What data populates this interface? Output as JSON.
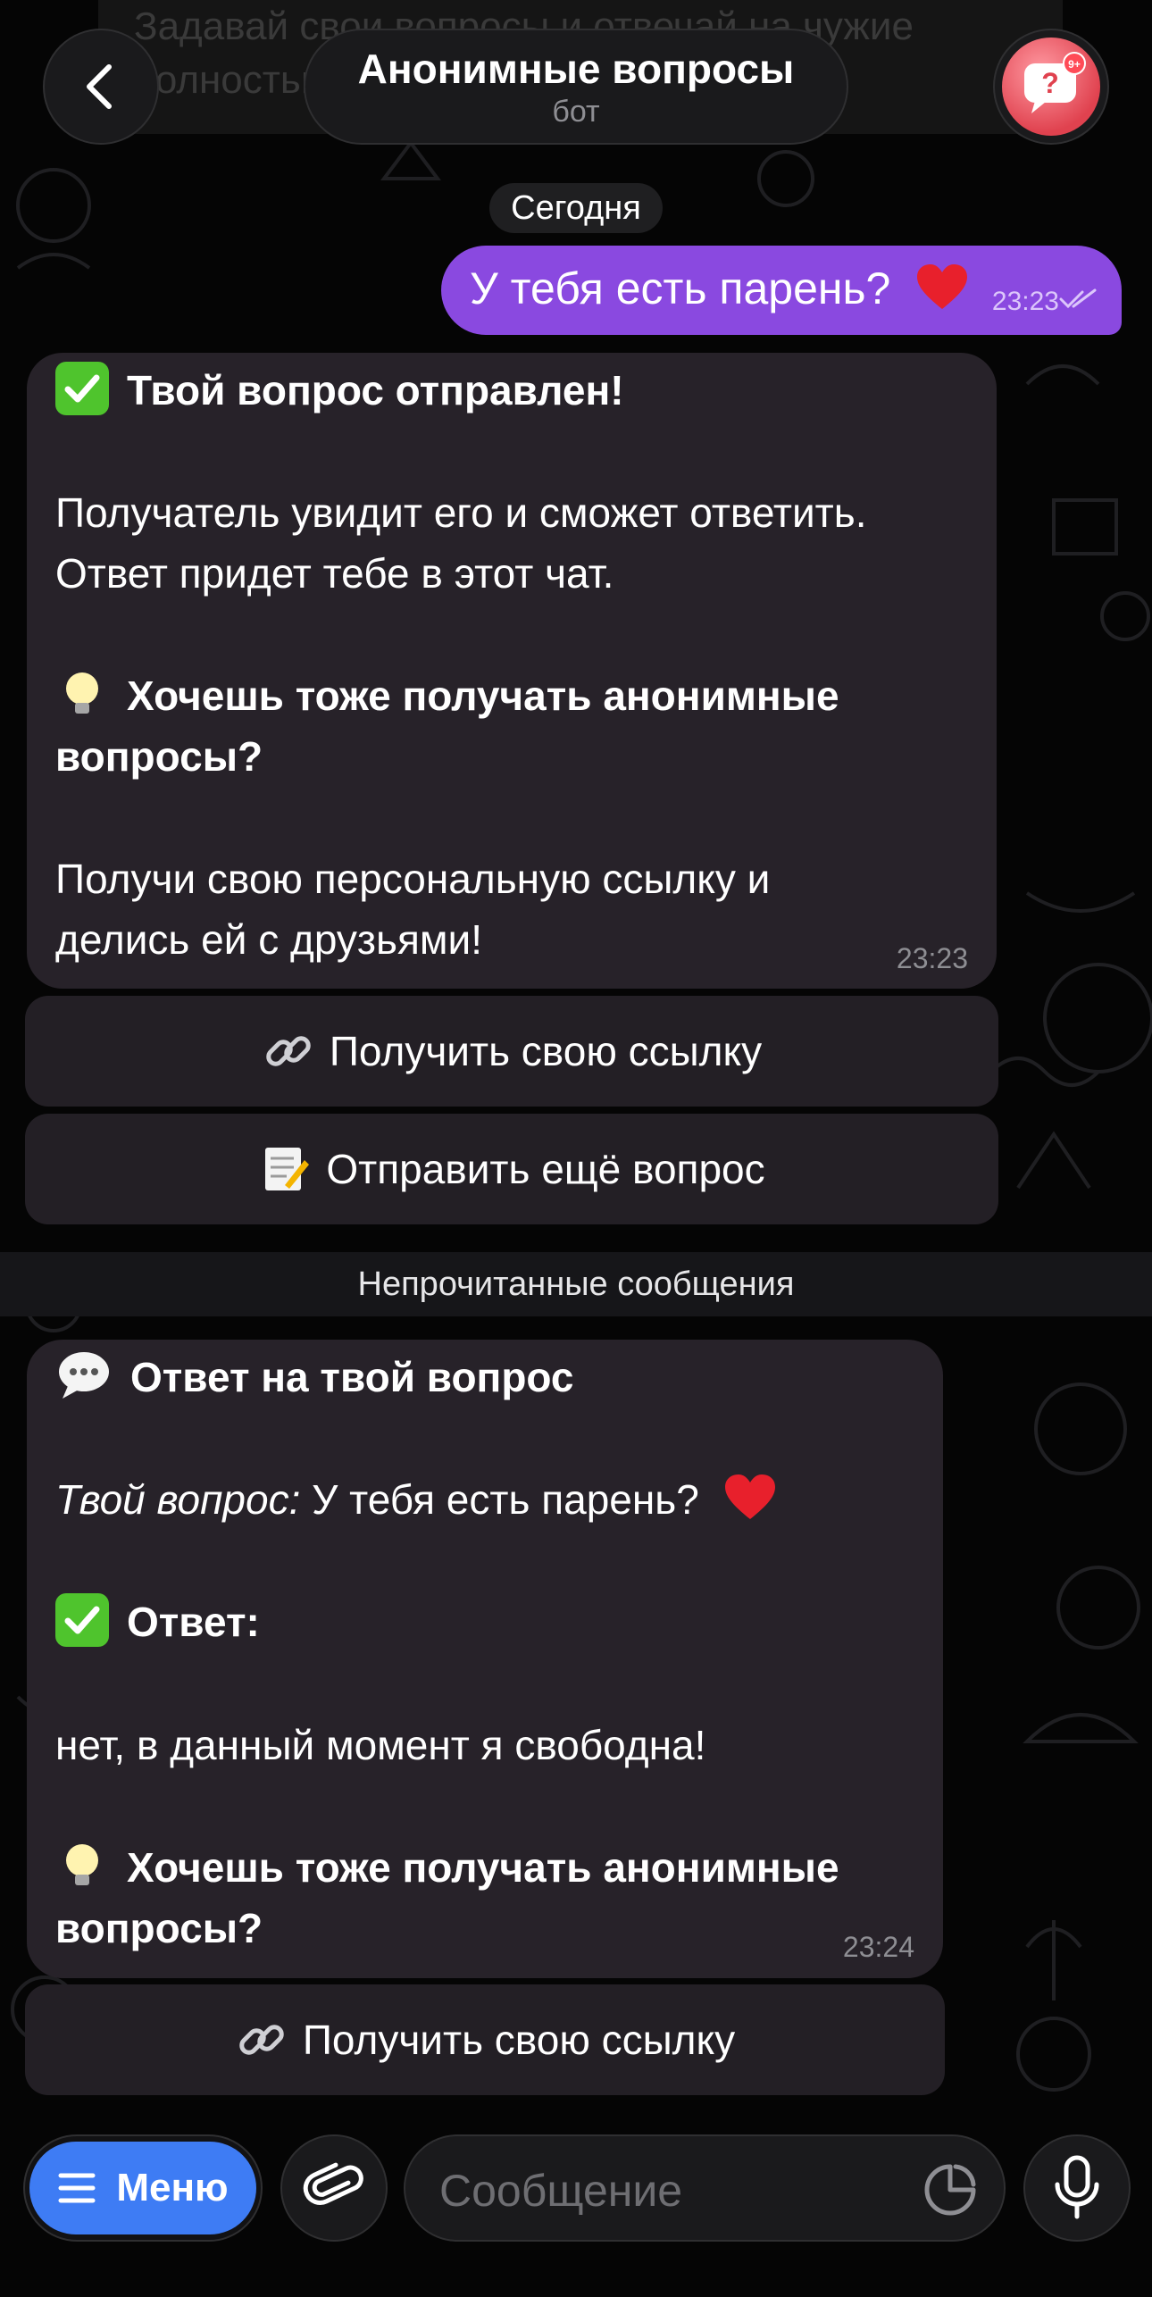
{
  "pinned": {
    "line1": "Задавай свои вопросы и отвечай на чужие",
    "line2": "полностью анонимно."
  },
  "header": {
    "title": "Анонимные вопросы",
    "subtitle": "бот",
    "avatar_badge": "9+"
  },
  "date_separator": "Сегодня",
  "outgoing": {
    "text": "У тебя есть парень?",
    "emoji": "heart",
    "time": "23:23",
    "status": "read"
  },
  "bot_message_1": {
    "title": "Твой вопрос отправлен!",
    "line1": "Получатель увидит его и сможет ответить.",
    "line2": "Ответ придет тебе в этот чат.",
    "promo_line1": "Хочешь тоже получать анонимные",
    "promo_line2": "вопросы?",
    "cta_line1": "Получи свою персональную ссылку и",
    "cta_line2": "делись ей с друзьями!",
    "time": "23:23"
  },
  "keyboard_1": {
    "get_link": "Получить свою ссылку",
    "send_more": "Отправить ещё вопрос"
  },
  "unread_separator": "Непрочитанные сообщения",
  "bot_message_2": {
    "title": "Ответ на твой вопрос",
    "question_label": "Твой вопрос:",
    "question_text": "У тебя есть парень?",
    "answer_label": "Ответ:",
    "answer_text": "нет, в данный момент я свободна!",
    "promo_line1": "Хочешь тоже получать анонимные",
    "promo_line2": "вопросы?",
    "time": "23:24"
  },
  "keyboard_2": {
    "get_link": "Получить свою ссылку"
  },
  "composer": {
    "menu_label": "Меню",
    "placeholder": "Сообщение"
  },
  "colors": {
    "accent": "#3e7cf4",
    "outgoing_bubble": "#8a49e0",
    "incoming_bubble": "#272229",
    "check_green": "#4fc42d"
  }
}
